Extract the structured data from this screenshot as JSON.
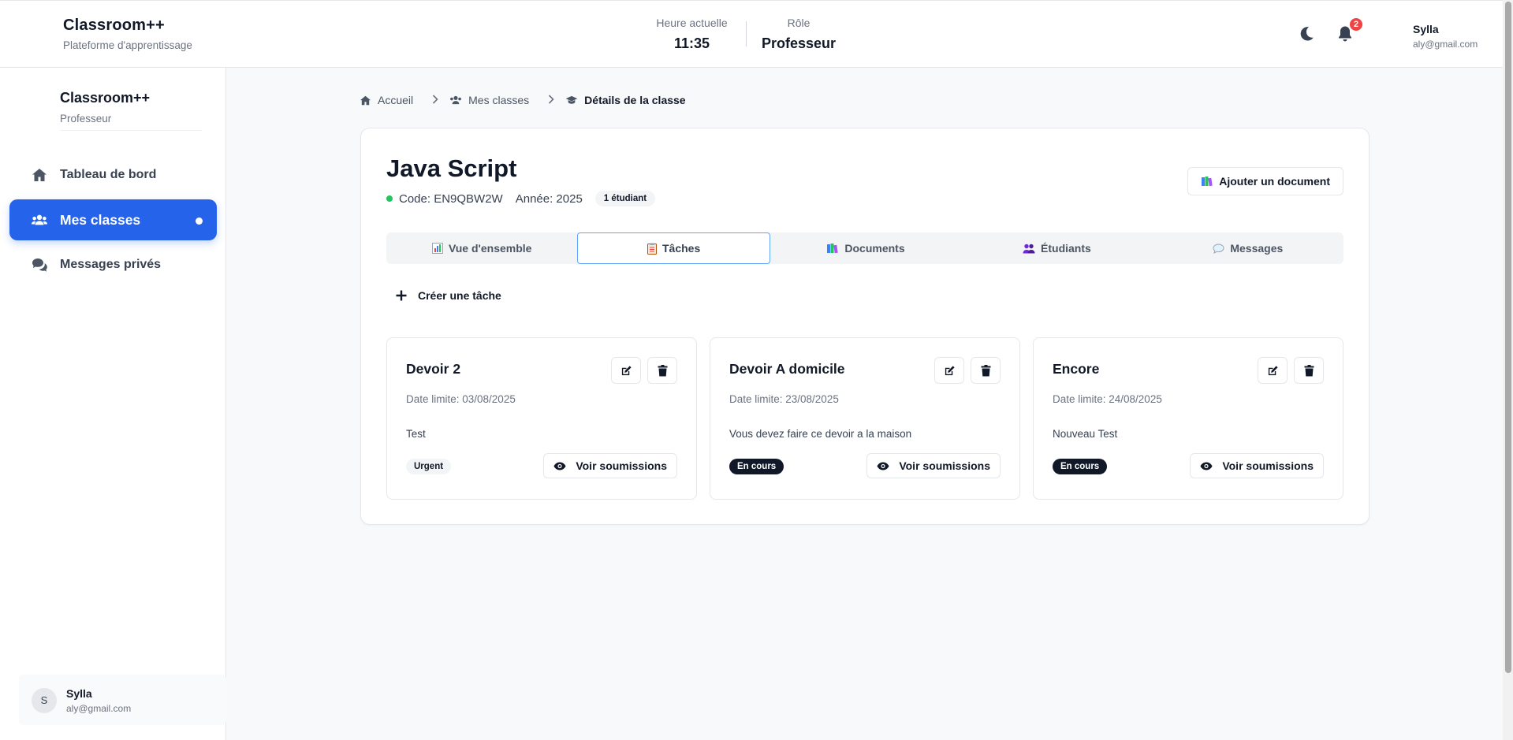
{
  "header": {
    "brand_title": "Classroom++",
    "brand_subtitle": "Plateforme d'apprentissage",
    "time_label": "Heure actuelle",
    "time_value": "11:35",
    "role_label": "Rôle",
    "role_value": "Professeur",
    "notification_count": "2",
    "user_name": "Sylla",
    "user_email": "aly@gmail.com"
  },
  "sidebar": {
    "brand_title": "Classroom++",
    "brand_subtitle": "Professeur",
    "items": [
      {
        "label": "Tableau de bord",
        "icon": "home-icon",
        "active": false
      },
      {
        "label": "Mes classes",
        "icon": "users-icon",
        "active": true
      },
      {
        "label": "Messages privés",
        "icon": "comments-icon",
        "active": false
      }
    ],
    "user": {
      "initial": "S",
      "name": "Sylla",
      "email": "aly@gmail.com"
    }
  },
  "breadcrumb": [
    {
      "label": "Accueil",
      "icon": "home-icon"
    },
    {
      "label": "Mes classes",
      "icon": "users-icon"
    },
    {
      "label": "Détails de la classe",
      "icon": "graduation-cap-icon"
    }
  ],
  "class": {
    "title": "Java Script",
    "code": "Code: EN9QBW2W",
    "year": "Année: 2025",
    "students": "1 étudiant",
    "add_document_label": "Ajouter un document"
  },
  "tabs": [
    {
      "label": "Vue d'ensemble",
      "icon": "bar-chart-icon",
      "active": false
    },
    {
      "label": "Tâches",
      "icon": "clipboard-icon",
      "active": true
    },
    {
      "label": "Documents",
      "icon": "books-icon",
      "active": false
    },
    {
      "label": "Étudiants",
      "icon": "people-icon",
      "active": false
    },
    {
      "label": "Messages",
      "icon": "speech-bubble-icon",
      "active": false
    }
  ],
  "create_task_label": "Créer une tâche",
  "tasks": [
    {
      "title": "Devoir 2",
      "deadline": "Date limite: 03/08/2025",
      "description": "Test",
      "status": "Urgent",
      "status_style": "urgent",
      "view_label": "Voir soumissions"
    },
    {
      "title": "Devoir A domicile",
      "deadline": "Date limite: 23/08/2025",
      "description": "Vous devez faire ce devoir a la maison",
      "status": "En cours",
      "status_style": "encours",
      "view_label": "Voir soumissions"
    },
    {
      "title": "Encore",
      "deadline": "Date limite: 24/08/2025",
      "description": "Nouveau Test",
      "status": "En cours",
      "status_style": "encours",
      "view_label": "Voir soumissions"
    }
  ],
  "colors": {
    "accent": "#2563eb",
    "badge_red": "#ef4444",
    "status_green": "#22c55e",
    "dark_badge": "#111827"
  }
}
